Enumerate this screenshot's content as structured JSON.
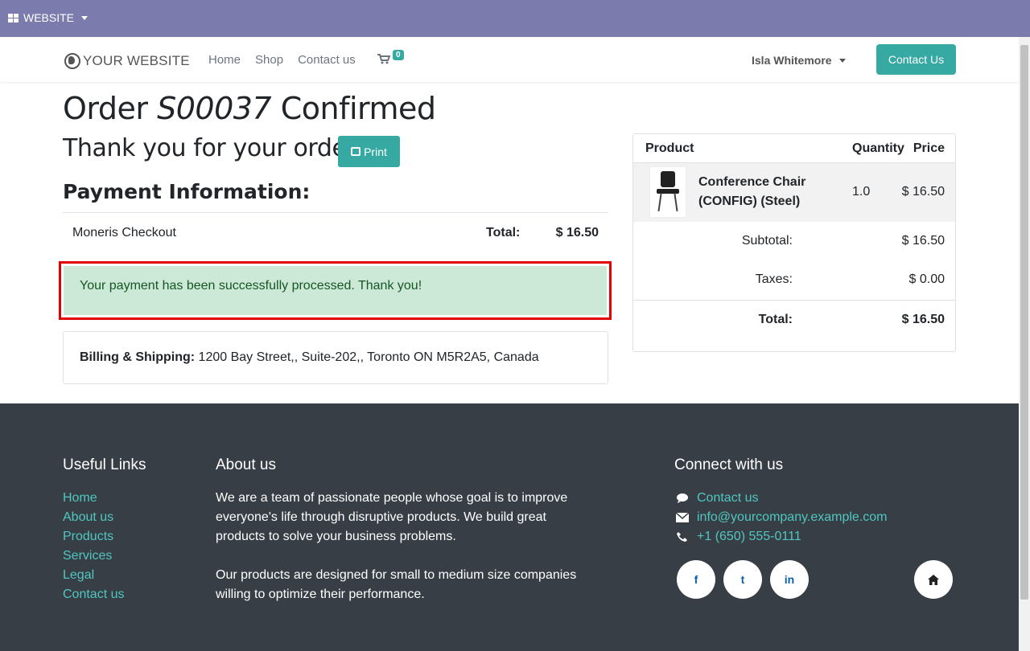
{
  "adminbar": {
    "menu_label": "WEBSITE"
  },
  "navbar": {
    "logo": "YOUR WEBSITE",
    "links": [
      "Home",
      "Shop",
      "Contact us"
    ],
    "cart_count": "0",
    "user_name": "Isla Whitemore",
    "contact_button": "Contact Us"
  },
  "order": {
    "title_prefix": "Order",
    "order_id": "S00037",
    "title_suffix": "Confirmed",
    "thanks": "Thank you for your order.",
    "print_label": "Print",
    "payment_heading": "Payment Information:",
    "payment_method": "Moneris Checkout",
    "total_label": "Total:",
    "total_amount": "$ 16.50",
    "success_message": "Your payment has been successfully processed. Thank you!",
    "billing_label": "Billing & Shipping:",
    "billing_address": "1200 Bay Street,, Suite-202,, Toronto ON M5R2A5, Canada"
  },
  "summary": {
    "col_product": "Product",
    "col_quantity": "Quantity",
    "col_price": "Price",
    "product_name": "Conference Chair (CONFIG) (Steel)",
    "product_qty": "1.0",
    "product_price": "$ 16.50",
    "subtotal_label": "Subtotal:",
    "subtotal_value": "$ 16.50",
    "taxes_label": "Taxes:",
    "taxes_value": "$ 0.00",
    "total_label": "Total:",
    "total_value": "$ 16.50"
  },
  "footer": {
    "useful_links_heading": "Useful Links",
    "useful_links": [
      "Home",
      "About us",
      "Products",
      "Services",
      "Legal",
      "Contact us"
    ],
    "about_heading": "About us",
    "about_p1": "We are a team of passionate people whose goal is to improve everyone's life through disruptive products. We build great products to solve your business problems.",
    "about_p2": "Our products are designed for small to medium size companies willing to optimize their performance.",
    "connect_heading": "Connect with us",
    "connect_contact": "Contact us",
    "connect_email": "info@yourcompany.example.com",
    "connect_phone": "+1 (650) 555-0111",
    "social": [
      "f",
      "t",
      "in"
    ]
  },
  "colors": {
    "admin_bar": "#7c7bad",
    "accent": "#35a9a2",
    "footer_bg": "#383e45",
    "success_bg": "#cce8d6",
    "highlight_border": "#e00000"
  }
}
